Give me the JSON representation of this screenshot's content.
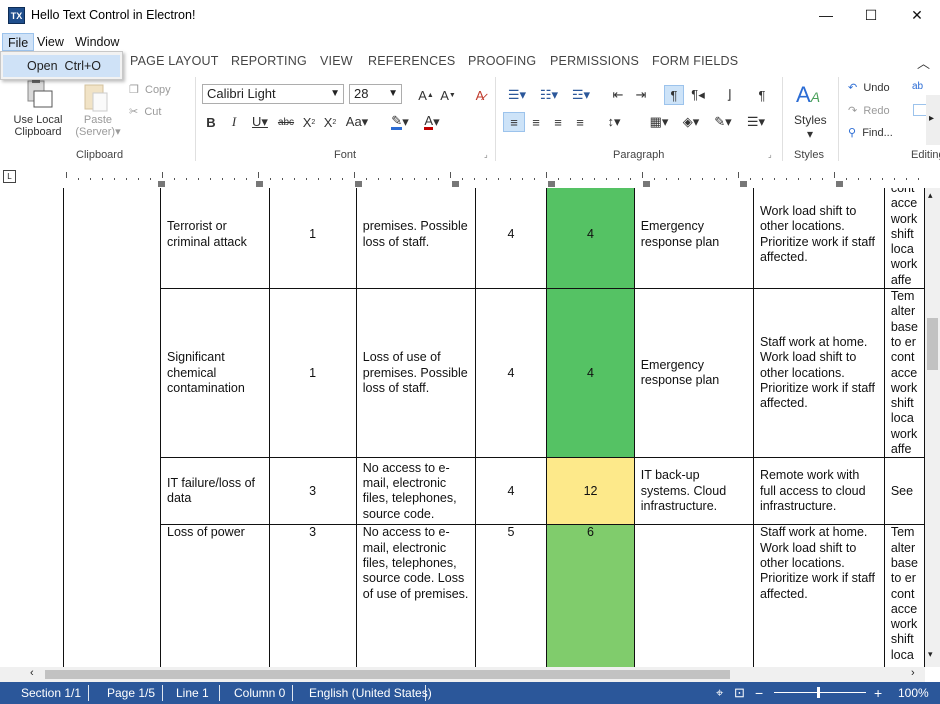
{
  "window": {
    "title": "Hello Text Control in Electron!",
    "app_icon_text": "TX",
    "minimize": "—",
    "maximize": "☐",
    "close": "✕"
  },
  "menubar": {
    "items": [
      "File",
      "View",
      "Window"
    ]
  },
  "file_menu": {
    "items": [
      {
        "label": "Open",
        "shortcut": "Ctrl+O"
      }
    ]
  },
  "ribbon_tabs": [
    "PAGE LAYOUT",
    "REPORTING",
    "VIEW",
    "REFERENCES",
    "PROOFING",
    "PERMISSIONS",
    "FORM FIELDS"
  ],
  "ribbon": {
    "clipboard": {
      "group": "Clipboard",
      "use_local": "Use Local",
      "clipboard_word": "Clipboard",
      "paste": "Paste",
      "paste_server": "(Server)",
      "copy": "Copy",
      "cut": "Cut"
    },
    "font": {
      "group": "Font",
      "font_name": "Calibri Light",
      "font_size": "28"
    },
    "paragraph": {
      "group": "Paragraph"
    },
    "styles": {
      "group": "Styles",
      "styles_label": "Styles"
    },
    "editing": {
      "group": "Editing",
      "undo": "Undo",
      "redo": "Redo",
      "find": "Find..."
    }
  },
  "table": {
    "rows": [
      {
        "c1": "Terrorist or criminal attack",
        "c2": "1",
        "c3": "premises. Possible loss of staff.",
        "c4": "4",
        "c5": "4",
        "c6": "Emergency response plan",
        "c7": "Work load shift to other locations. Prioritize work if staff affected.",
        "c8": "cont acce work shift loca work affe",
        "color": "#55c264"
      },
      {
        "c1": "Significant chemical contamination",
        "c2": "1",
        "c3": "Loss of use of premises. Possible loss of staff.",
        "c4": "4",
        "c5": "4",
        "c6": "Emergency response plan",
        "c7": "Staff work at home. Work load shift to other locations. Prioritize work if staff affected.",
        "c8": "Tem alter base to er cont acce work shift loca work affe",
        "color": "#55c264"
      },
      {
        "c1": "IT failure/loss of data",
        "c2": "3",
        "c3": "No access to e-mail, electronic files, telephones, source code.",
        "c4": "4",
        "c5": "12",
        "c6": "IT back-up systems. Cloud infrastructure.",
        "c7": "Remote work with full access to cloud infrastructure.",
        "c8": "See",
        "color": "#fde98a"
      },
      {
        "c1": "Loss of power",
        "c2": "3",
        "c3": "No access to e-mail, electronic files, telephones, source code. Loss of use of premises.",
        "c4": "5",
        "c5": "6",
        "c6": "",
        "c7": "Staff work at home. Work load shift to other locations. Prioritize work if staff affected.",
        "c8": "Tem alter base to er cont acce work shift loca",
        "color": "#80cc6c"
      }
    ]
  },
  "status": {
    "section": "Section 1/1",
    "page": "Page 1/5",
    "line": "Line 1",
    "column": "Column 0",
    "language": "English (United States)",
    "zoom": "100%"
  }
}
